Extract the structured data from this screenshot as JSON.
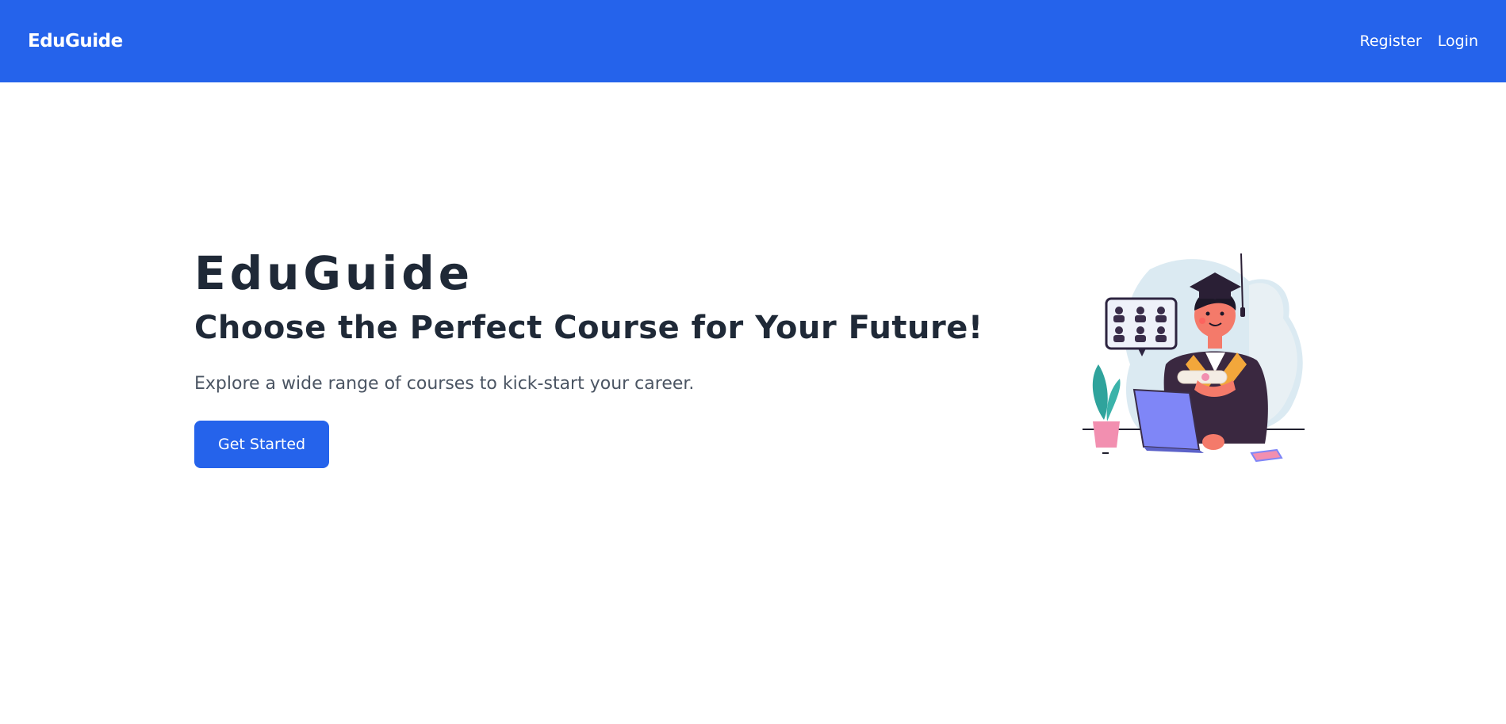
{
  "navbar": {
    "brand": "EduGuide",
    "links": [
      {
        "label": "Register"
      },
      {
        "label": "Login"
      }
    ]
  },
  "hero": {
    "title": "EduGuide",
    "subtitle": "Choose the Perfect Course for Your Future!",
    "description": "Explore a wide range of courses to kick-start your career.",
    "cta_label": "Get Started"
  },
  "colors": {
    "primary": "#2563eb",
    "heading": "#1f2937",
    "body_text": "#4b5563",
    "background": "#ffffff"
  },
  "illustration": {
    "icon": "graduate-student-laptop-illustration"
  }
}
